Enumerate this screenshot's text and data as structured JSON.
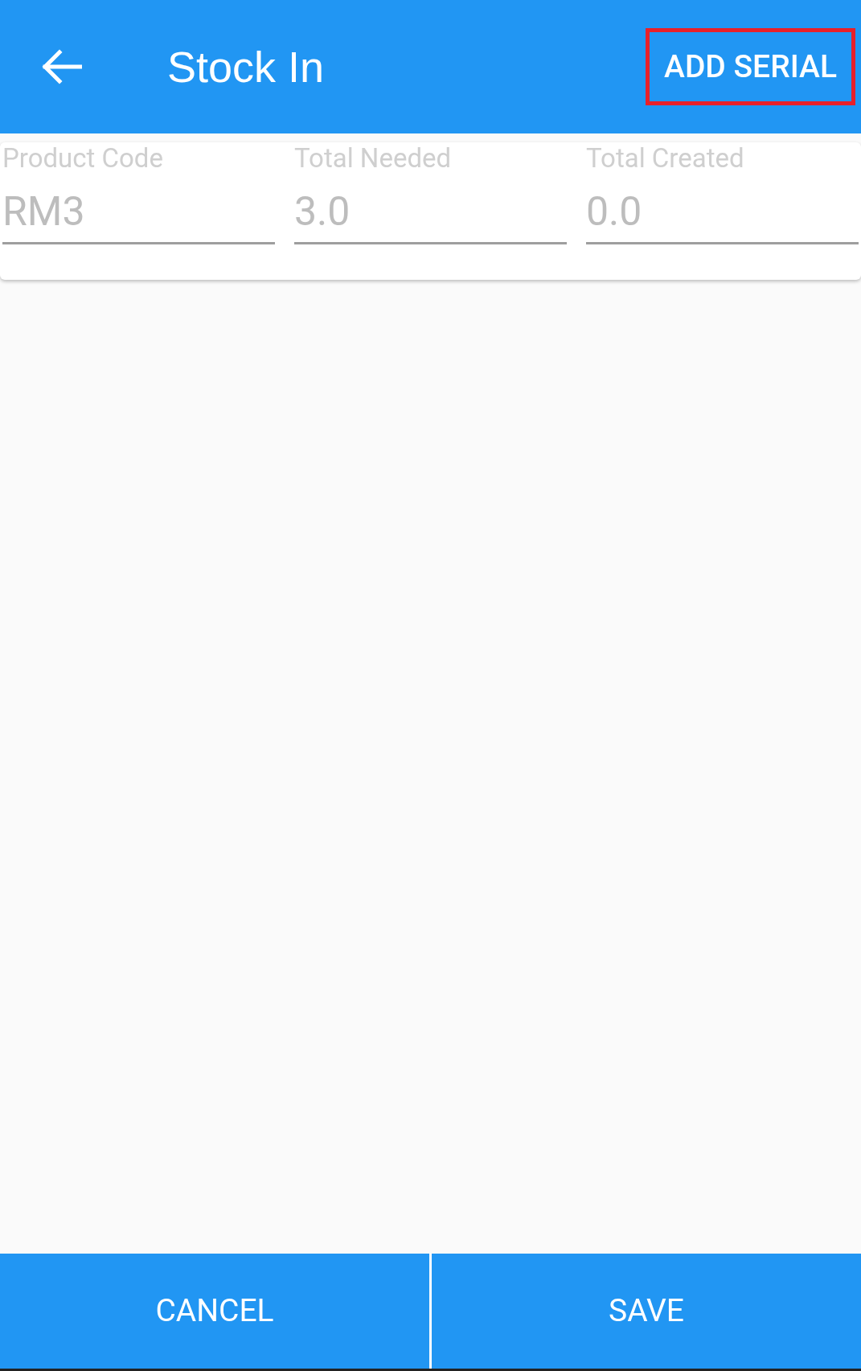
{
  "app_bar": {
    "title": "Stock In",
    "action": {
      "label": "ADD SERIAL",
      "highlighted": true
    }
  },
  "fields": [
    {
      "label": "Product Code",
      "value": "RM3"
    },
    {
      "label": "Total Needed",
      "value": "3.0"
    },
    {
      "label": "Total Created",
      "value": "0.0"
    }
  ],
  "buttons": [
    {
      "label": "CANCEL"
    },
    {
      "label": "SAVE"
    }
  ]
}
